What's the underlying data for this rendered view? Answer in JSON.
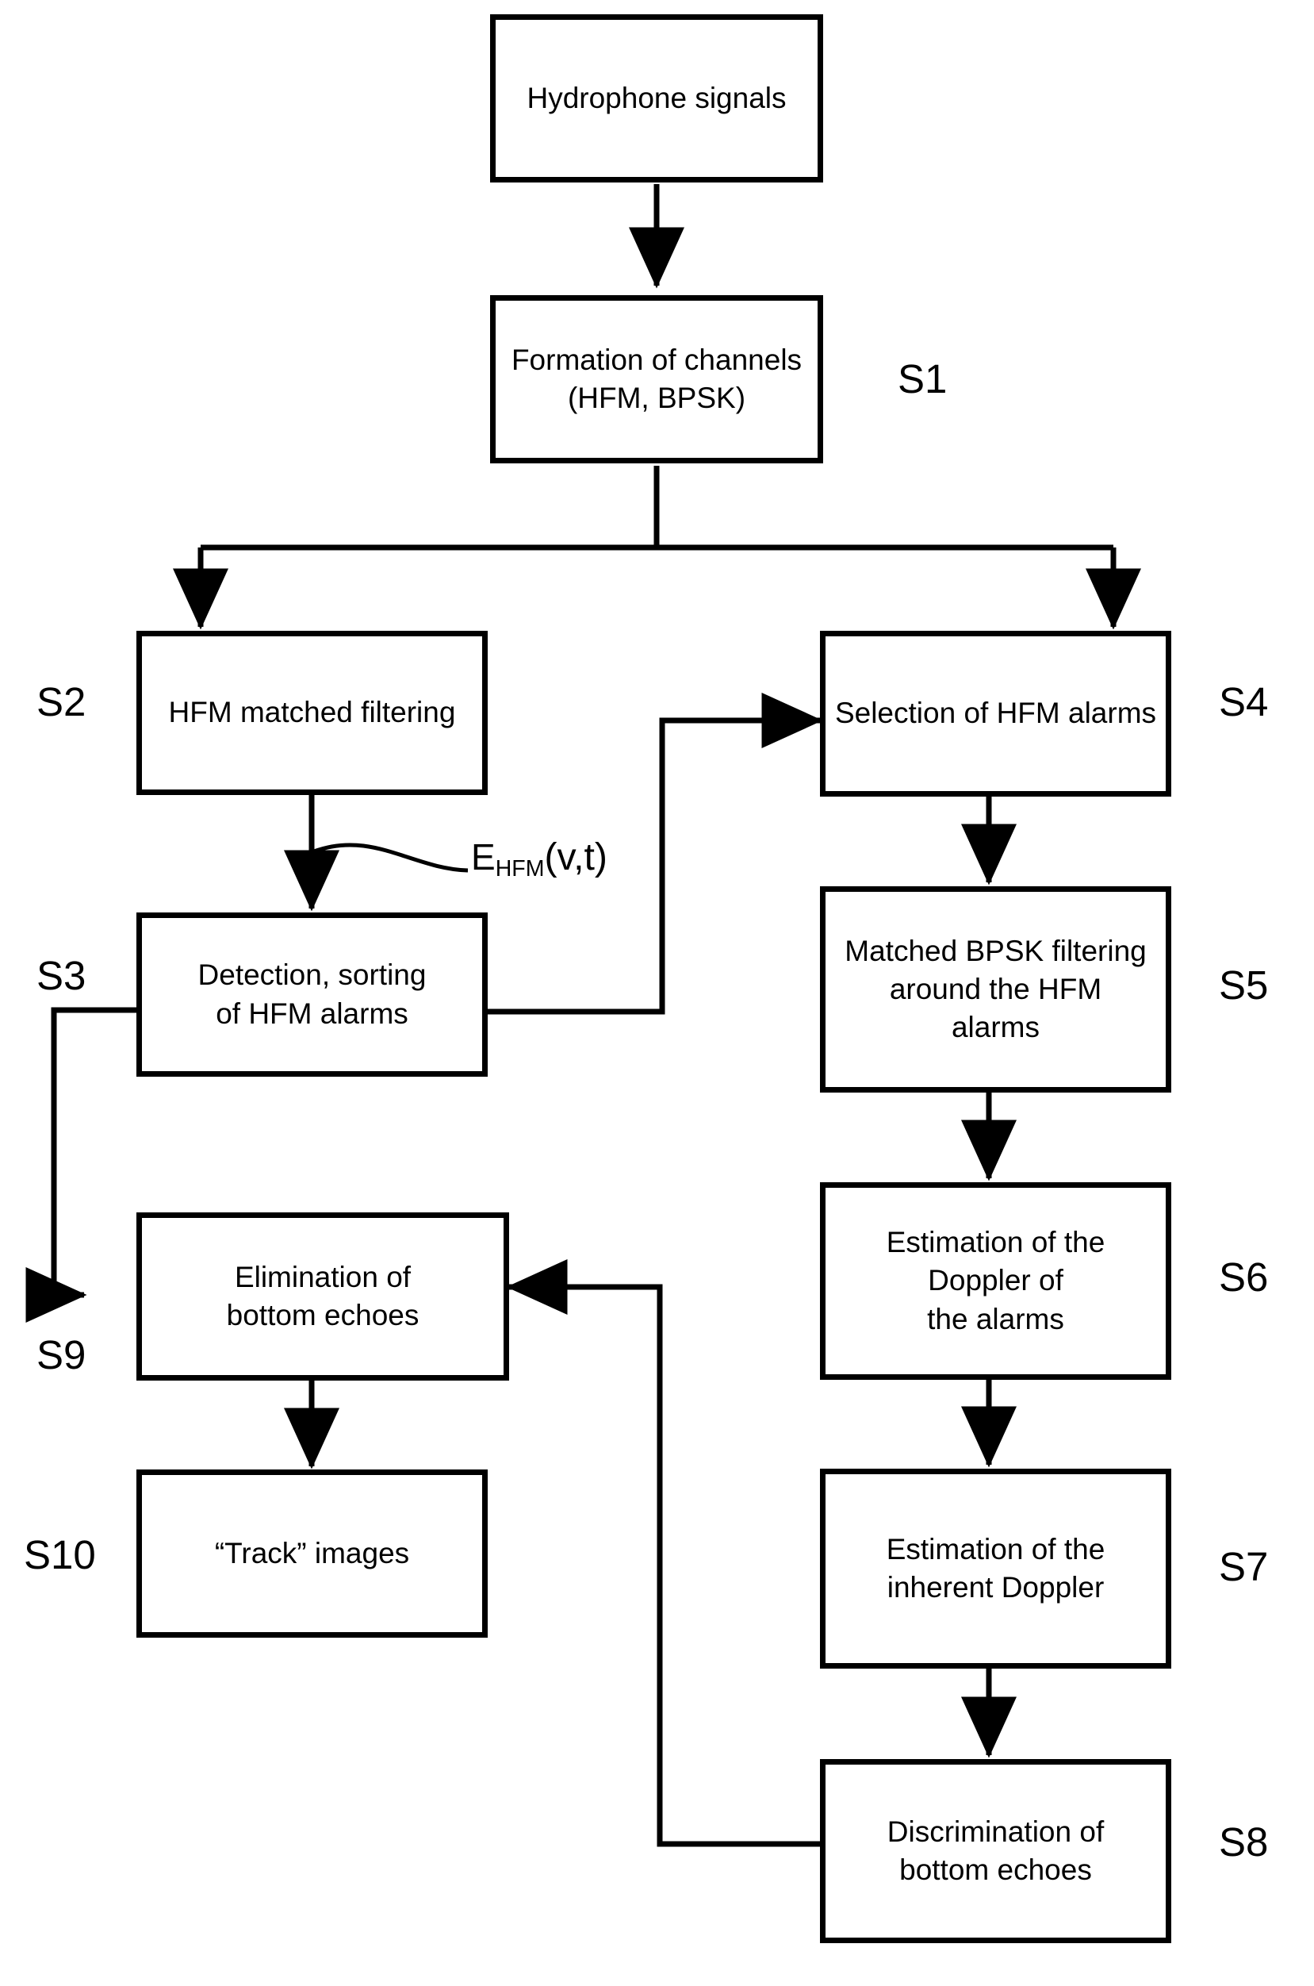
{
  "figure": {
    "type": "flowchart",
    "orientation": "top-to-bottom, two parallel branches",
    "line_color": "#000000",
    "background_color": "#ffffff"
  },
  "nodes": {
    "input": {
      "text": "Hydrophone signals",
      "step": ""
    },
    "s1": {
      "text": "Formation of channels\n(HFM, BPSK)",
      "step": "S1"
    },
    "s2": {
      "text": "HFM matched filtering",
      "step": "S2"
    },
    "s3": {
      "text": "Detection, sorting\nof HFM alarms",
      "step": "S3"
    },
    "s9": {
      "text": "Elimination of\nbottom echoes",
      "step": "S9"
    },
    "s10": {
      "text": "“Track” images",
      "step": "S10"
    },
    "s4": {
      "text": "Selection of HFM alarms",
      "step": "S4"
    },
    "s5": {
      "text": "Matched BPSK filtering\naround the HFM\nalarms",
      "step": "S5"
    },
    "s6": {
      "text": "Estimation of the\nDoppler of\nthe alarms",
      "step": "S6"
    },
    "s7": {
      "text": "Estimation of the\ninherent Doppler",
      "step": "S7"
    },
    "s8": {
      "text": "Discrimination of\nbottom echoes",
      "step": "S8"
    }
  },
  "annotations": {
    "signal_label": {
      "symbol": "E",
      "subscript": "HFM",
      "argument": "(v,t)",
      "attached_to": "s2-to-s3-arrow"
    }
  },
  "edges": [
    {
      "from": "input",
      "to": "s1",
      "style": "straight-down-arrow"
    },
    {
      "from": "s1",
      "to": "s2",
      "style": "split-left-branch-arrow"
    },
    {
      "from": "s1",
      "to": "s4",
      "style": "split-right-branch-arrow"
    },
    {
      "from": "s2",
      "to": "s3",
      "style": "straight-down-arrow"
    },
    {
      "from": "s3",
      "to": "s4",
      "style": "right-then-up-arrow"
    },
    {
      "from": "s3",
      "to": "s9",
      "style": "left-then-down-arrow"
    },
    {
      "from": "s9",
      "to": "s10",
      "style": "straight-down-arrow"
    },
    {
      "from": "s4",
      "to": "s5",
      "style": "straight-down-arrow"
    },
    {
      "from": "s5",
      "to": "s6",
      "style": "straight-down-arrow"
    },
    {
      "from": "s6",
      "to": "s7",
      "style": "straight-down-arrow"
    },
    {
      "from": "s7",
      "to": "s8",
      "style": "straight-down-arrow"
    },
    {
      "from": "s8",
      "to": "s9",
      "style": "left-then-up-feedback-arrow"
    }
  ]
}
